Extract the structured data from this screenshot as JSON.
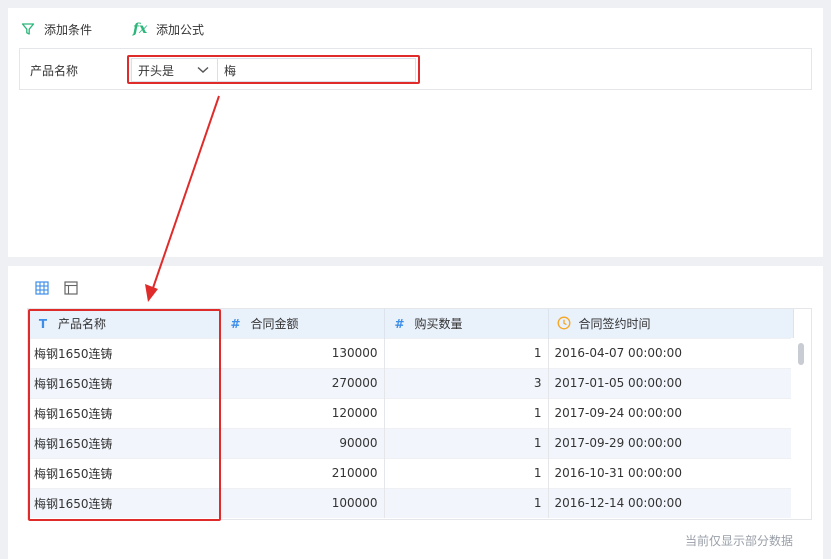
{
  "toolbar": {
    "add_condition_label": "添加条件",
    "add_formula_label": "添加公式"
  },
  "condition": {
    "field_label": "产品名称",
    "operator": "开头是",
    "value": "梅"
  },
  "table": {
    "columns": [
      {
        "name": "产品名称",
        "type_icon": "T"
      },
      {
        "name": "合同金额",
        "type_icon": "#"
      },
      {
        "name": "购买数量",
        "type_icon": "#"
      },
      {
        "name": "合同签约时间",
        "type_icon": "clock-icon"
      }
    ],
    "rows": [
      [
        "梅钢1650连铸",
        "130000",
        "1",
        "2016-04-07 00:00:00"
      ],
      [
        "梅钢1650连铸",
        "270000",
        "3",
        "2017-01-05 00:00:00"
      ],
      [
        "梅钢1650连铸",
        "120000",
        "1",
        "2017-09-24 00:00:00"
      ],
      [
        "梅钢1650连铸",
        "90000",
        "1",
        "2017-09-29 00:00:00"
      ],
      [
        "梅钢1650连铸",
        "210000",
        "1",
        "2016-10-31 00:00:00"
      ],
      [
        "梅钢1650连铸",
        "100000",
        "1",
        "2016-12-14 00:00:00"
      ]
    ]
  },
  "footer_note": "当前仅显示部分数据",
  "colors": {
    "accent_green": "#2bb67a",
    "header_blue": "#e9f1fb",
    "highlight_red": "#e02b2b",
    "clock_orange": "#f5a623"
  }
}
